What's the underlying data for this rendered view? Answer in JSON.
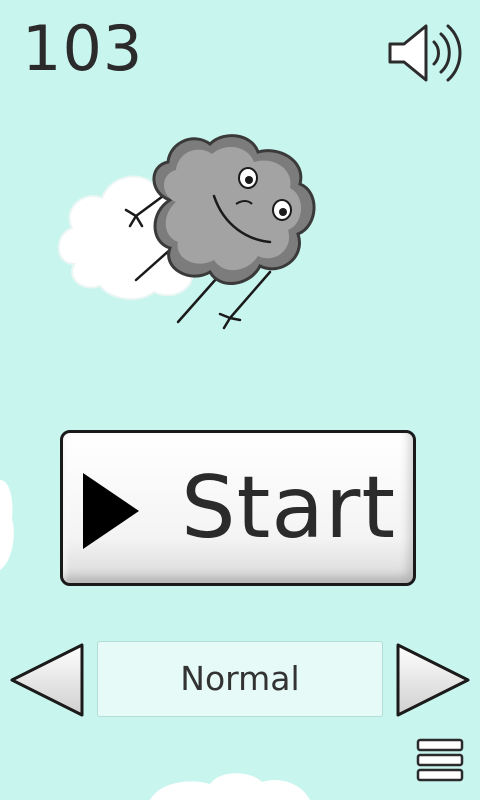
{
  "score": "103",
  "start_button": {
    "label": "Start"
  },
  "difficulty": {
    "selected": "Normal"
  },
  "icons": {
    "sound": "speaker-volume-icon",
    "play": "play-triangle-icon",
    "previous": "left-arrow-icon",
    "next": "right-arrow-icon",
    "menu": "hamburger-menu-icon"
  },
  "colors": {
    "background": "#c8f5ee",
    "cloud_character": "#999999",
    "cloud_white": "#ffffff",
    "text": "#2b2b2b",
    "mode_box": "#e6fbf7"
  }
}
